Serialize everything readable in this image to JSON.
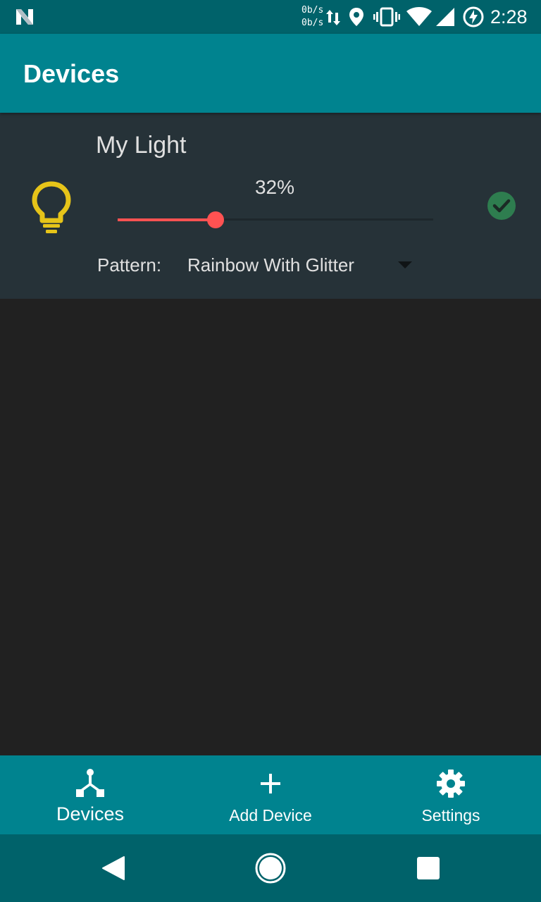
{
  "status_bar": {
    "net_up": "0b/s",
    "net_down": "0b/s",
    "time": "2:28"
  },
  "app_bar": {
    "title": "Devices"
  },
  "device": {
    "name": "My Light",
    "brightness_label": "32%",
    "brightness_fraction": 0.31,
    "pattern_label": "Pattern:",
    "pattern_value": "Rainbow With Glitter",
    "icon": "lightbulb-outline-icon",
    "status_icon": "check-circle-icon"
  },
  "bottom_nav": {
    "items": [
      {
        "label": "Devices",
        "icon": "device-hub-icon"
      },
      {
        "label": "Add Device",
        "icon": "plus-icon"
      },
      {
        "label": "Settings",
        "icon": "gear-icon"
      }
    ]
  },
  "colors": {
    "status_bar": "#00626a",
    "app_bar": "#00838f",
    "card": "#263238",
    "background": "#212121",
    "accent": "#ff5252",
    "bulb": "#e6c419",
    "status_ok": "#2e7d4f"
  }
}
